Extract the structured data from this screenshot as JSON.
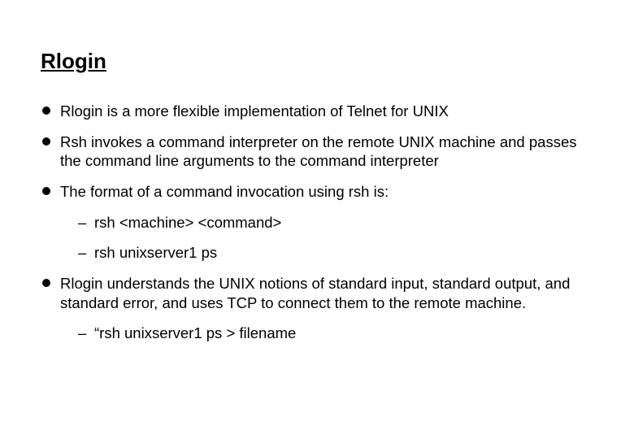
{
  "title": "Rlogin",
  "bullets": {
    "b1": "Rlogin is a more flexible implementation of Telnet for UNIX",
    "b2": "Rsh invokes a command interpreter on the remote UNIX machine and passes the command line arguments to the command interpreter",
    "b3": "The format of a command invocation using rsh is:",
    "b3_sub1": "rsh <machine> <command>",
    "b3_sub2": "rsh unixserver1 ps",
    "b4": "Rlogin understands the UNIX notions of standard input, standard output, and standard error, and uses TCP to connect them to the remote machine.",
    "b4_sub1": "“rsh unixserver1 ps > filename"
  }
}
